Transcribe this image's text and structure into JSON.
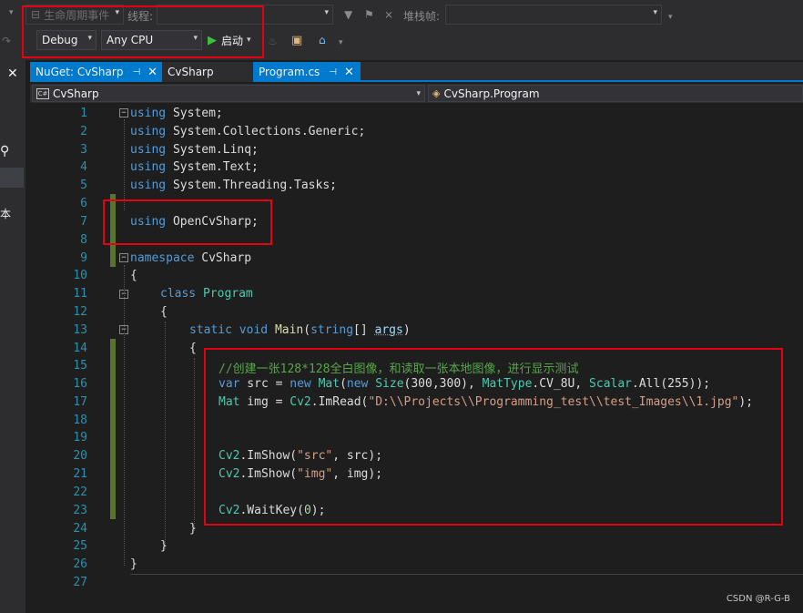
{
  "toolbar": {
    "lifecycle_events": "生命周期事件",
    "thread_label": "线程:",
    "stack_frame_label": "堆栈帧:",
    "config": "Debug",
    "platform": "Any CPU",
    "start_label": "启动"
  },
  "tabs": [
    {
      "label": "NuGet: CvSharp",
      "pin": "⊣",
      "close": "✕"
    },
    {
      "label": "CvSharp"
    },
    {
      "label": "Program.cs",
      "pin": "⊣",
      "close": "✕"
    }
  ],
  "navbar": {
    "project": "CvSharp",
    "class_path": "CvSharp.Program"
  },
  "left_panel": {
    "close": "✕",
    "char": "本"
  },
  "code": {
    "line_numbers": [
      "1",
      "2",
      "3",
      "4",
      "5",
      "6",
      "7",
      "8",
      "9",
      "10",
      "11",
      "12",
      "13",
      "14",
      "15",
      "16",
      "17",
      "18",
      "19",
      "20",
      "21",
      "22",
      "23",
      "24",
      "25",
      "26",
      "27"
    ],
    "l1_kw": "using",
    "l1_rest": " System;",
    "l2_kw": "using",
    "l2_rest": " System.Collections.Generic;",
    "l3_kw": "using",
    "l3_rest": " System.Linq;",
    "l4_kw": "using",
    "l4_rest": " System.Text;",
    "l5_kw": "using",
    "l5_rest": " System.Threading.Tasks;",
    "l7_kw": "using",
    "l7_rest": " OpenCvSharp;",
    "l9_kw": "namespace",
    "l9_rest": " CvSharp",
    "brace_open": "{",
    "brace_close": "}",
    "l11_kw": "class",
    "l11_type": "Program",
    "l13_kw1": "static",
    "l13_kw2": "void",
    "l13_fn": "Main",
    "l13_kw3": "string",
    "l13_arr": "[] ",
    "l13_param": "args",
    "l13_close": ")",
    "l15_comment": "//创建一张128*128全白图像，和读取一张本地图像，进行显示测试",
    "l16_var": "var",
    "l16_name": " src = ",
    "l16_new": "new",
    "l16_mat": "Mat",
    "l16_new2": "new",
    "l16_size": "Size",
    "l16_nums": "(300,300), ",
    "l16_mattype": "MatType",
    "l16_cv8u": ".CV_8U, ",
    "l16_scalar": "Scalar",
    "l16_all": ".All(",
    "l16_255": "255",
    "l16_end": "));",
    "l17_mat": "Mat",
    "l17_img": " img = ",
    "l17_cv2": "Cv2",
    "l17_imread": ".ImRead(",
    "l17_str": "\"D:\\\\Projects\\\\Programming_test\\\\test_Images\\\\1.jpg\"",
    "l17_end": ");",
    "l20_cv2": "Cv2",
    "l20_call": ".ImShow(",
    "l20_str": "\"src\"",
    "l20_rest": ", src);",
    "l21_cv2": "Cv2",
    "l21_call": ".ImShow(",
    "l21_str": "\"img\"",
    "l21_rest": ", img);",
    "l23_cv2": "Cv2",
    "l23_call": ".WaitKey(",
    "l23_num": "0",
    "l23_end": ");"
  },
  "watermark": "CSDN @R-G-B",
  "colors": {
    "accent": "#007acc",
    "highlight_box": "#e60012",
    "keyword": "#569cd6",
    "type": "#4ec9b0",
    "string": "#d69d85",
    "comment": "#57a64a"
  }
}
